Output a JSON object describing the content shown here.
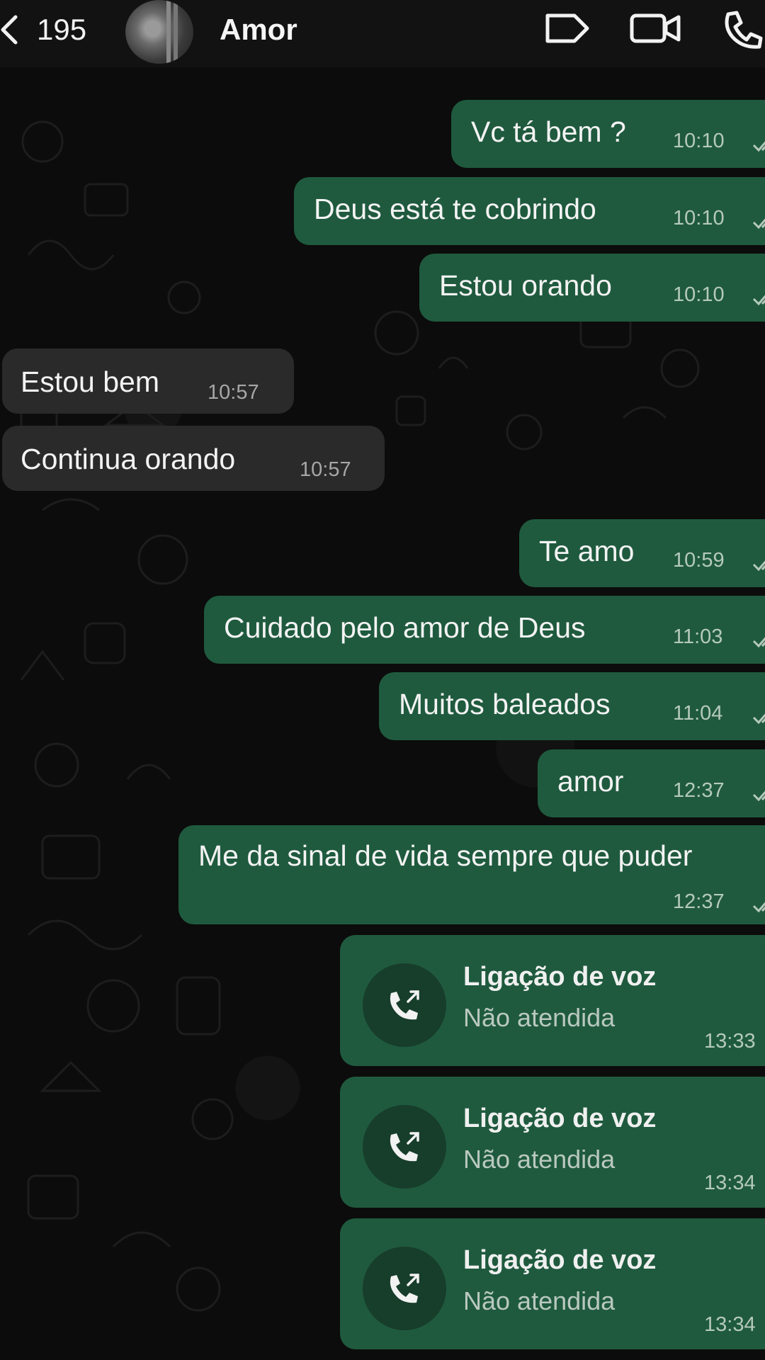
{
  "header": {
    "back_icon": "chevron-left-icon",
    "unread_count": "195",
    "contact_name": "Amor",
    "icons": [
      "label-icon",
      "video-camera-icon",
      "phone-icon"
    ]
  },
  "messages": [
    {
      "dir": "out",
      "text": "Vc tá bem ?",
      "time": "10:10"
    },
    {
      "dir": "out",
      "text": "Deus está te cobrindo",
      "time": "10:10"
    },
    {
      "dir": "out",
      "text": "Estou orando",
      "time": "10:10"
    },
    {
      "dir": "in",
      "text": "Estou bem",
      "time": "10:57"
    },
    {
      "dir": "in",
      "text": "Continua orando",
      "time": "10:57"
    },
    {
      "dir": "out",
      "text": "Te amo",
      "time": "10:59"
    },
    {
      "dir": "out",
      "text": "Cuidado pelo amor de Deus",
      "time": "11:03"
    },
    {
      "dir": "out",
      "text": "Muitos baleados",
      "time": "11:04"
    },
    {
      "dir": "out",
      "text": "amor",
      "time": "12:37"
    },
    {
      "dir": "out",
      "text": "Me da sinal de vida sempre que puder",
      "time": "12:37"
    }
  ],
  "calls": [
    {
      "title": "Ligação de voz",
      "status": "Não atendida",
      "time": "13:33"
    },
    {
      "title": "Ligação de voz",
      "status": "Não atendida",
      "time": "13:34"
    },
    {
      "title": "Ligação de voz",
      "status": "Não atendida",
      "time": "13:34"
    }
  ],
  "colors": {
    "outgoing_bubble": "#1f5a3e",
    "incoming_bubble": "#2a2a2a",
    "background": "#0c0c0c"
  }
}
